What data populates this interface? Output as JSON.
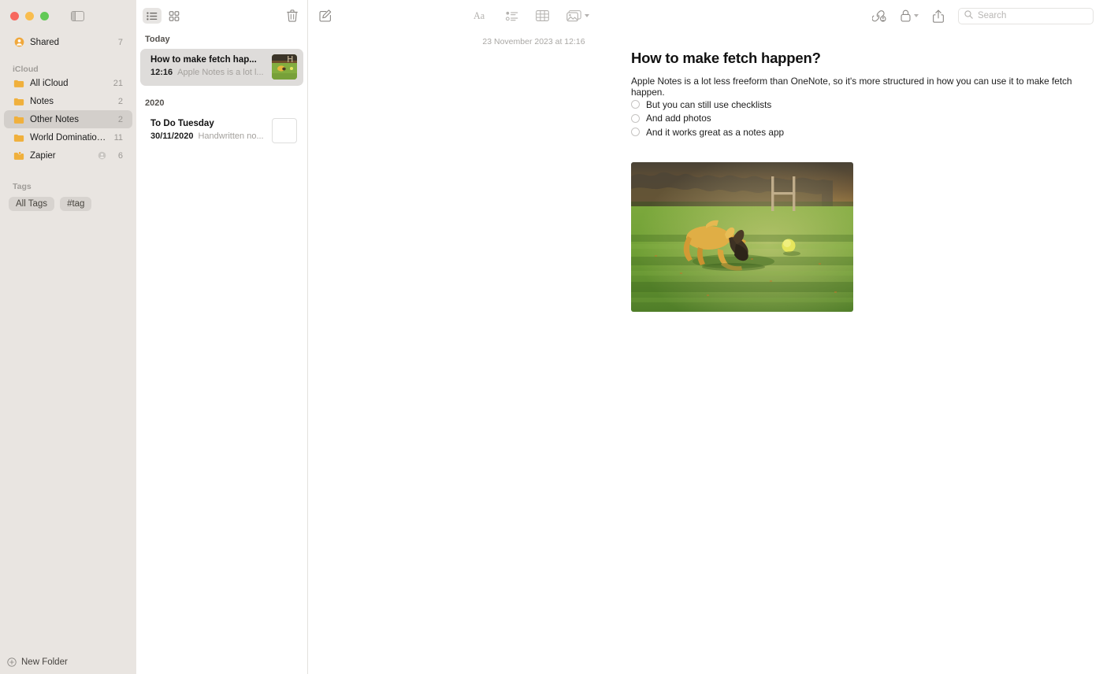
{
  "window": {
    "traffic_lights": [
      "close-button",
      "minimize-button",
      "zoom-button"
    ],
    "sidebar_toggle": "sidebar-toggle-icon"
  },
  "sidebar": {
    "shared": {
      "label": "Shared",
      "count": "7",
      "icon": "shared-person-icon"
    },
    "icloud_header": "iCloud",
    "folders": [
      {
        "label": "All iCloud",
        "count": "21",
        "icon": "folder-icon",
        "shared": false,
        "selected": false
      },
      {
        "label": "Notes",
        "count": "2",
        "icon": "folder-icon",
        "shared": false,
        "selected": false
      },
      {
        "label": "Other Notes",
        "count": "2",
        "icon": "folder-icon",
        "shared": false,
        "selected": true
      },
      {
        "label": "World Domination Pla...",
        "count": "11",
        "icon": "folder-icon",
        "shared": false,
        "selected": false
      },
      {
        "label": "Zapier",
        "count": "6",
        "icon": "shared-folder-icon",
        "shared": true,
        "selected": false
      }
    ],
    "tags_header": "Tags",
    "tags": [
      {
        "label": "All Tags"
      },
      {
        "label": "#tag"
      }
    ],
    "new_folder": {
      "label": "New Folder",
      "icon": "plus-circle-icon"
    }
  },
  "notes_list": {
    "toolbar": {
      "list_view": "list-view-icon",
      "gallery_view": "gallery-view-icon",
      "delete": "trash-icon"
    },
    "sections": [
      {
        "header": "Today",
        "notes": [
          {
            "title": "How to make fetch hap...",
            "date": "12:16",
            "snippet": "Apple Notes is a lot l...",
            "selected": true,
            "thumb": "photo"
          }
        ]
      },
      {
        "header": "2020",
        "notes": [
          {
            "title": "To Do Tuesday",
            "date": "30/11/2020",
            "snippet": "Handwritten no...",
            "selected": false,
            "thumb": "blank"
          }
        ]
      }
    ]
  },
  "main_toolbar": {
    "compose": "compose-note-icon",
    "format": "format-text-icon",
    "checklist": "checklist-icon",
    "table": "table-icon",
    "media": "media-icon",
    "media_chevron": "chevron-down-icon",
    "collaborate": "collaborate-icon",
    "lock": "lock-icon",
    "lock_chevron": "chevron-down-icon",
    "share": "share-icon",
    "search": {
      "icon": "search-icon",
      "value": "",
      "placeholder": "Search"
    }
  },
  "note": {
    "timestamp": "23 November 2023 at 12:16",
    "title": "How to make fetch happen?",
    "paragraph": "Apple Notes is a lot less freeform than OneNote, so it's more structured in how you can use it to make fetch happen.",
    "checklist": [
      {
        "label": "But you can still use checklists",
        "checked": false
      },
      {
        "label": "And add photos",
        "checked": false
      },
      {
        "label": "And it works great as a notes app",
        "checked": false
      }
    ],
    "photo_alt": "Dog running toward a tennis ball on a grass field with rugby posts"
  },
  "colors": {
    "sidebar_bg": "#e9e5e1",
    "selected_row": "#d3cfcb",
    "folder_yellow": "#f0b03c",
    "accent_orange": "#f5a623",
    "note_selected": "#dedcda"
  }
}
